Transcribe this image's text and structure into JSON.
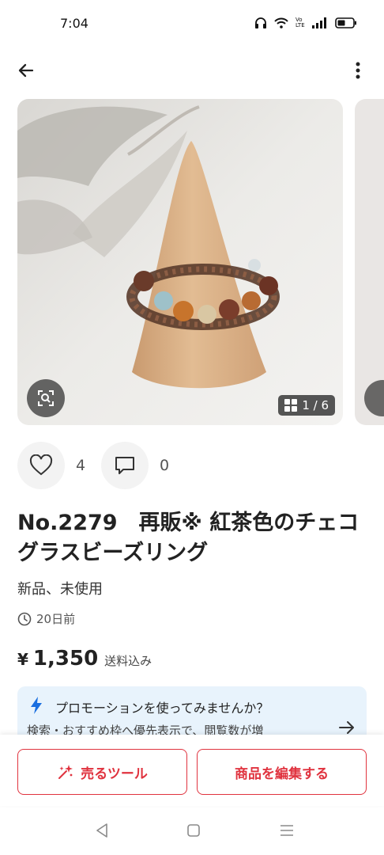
{
  "status_bar": {
    "time": "7:04",
    "network_label": "Vo LTE"
  },
  "product": {
    "photo_counter": "1 / 6",
    "likes_count": "4",
    "comments_count": "0",
    "title": "No.2279　再販※ 紅茶色のチェコグラスビーズリング",
    "condition": "新品、未使用",
    "posted_time": "20日前",
    "price_currency": "¥",
    "price_value": "1,350",
    "price_note": "送料込み"
  },
  "promotion": {
    "title": "プロモーションを使ってみませんか？",
    "body": "検索・おすすめ枠へ優先表示で、閲覧数が増"
  },
  "bottom_actions": {
    "sell_tools_label": "売るツール",
    "edit_label": "商品を編集する"
  },
  "colors": {
    "accent_red": "#e0333f",
    "promo_bg": "#e8f3fc",
    "promo_bolt": "#1a6fe0"
  },
  "icons": [
    "back-arrow-icon",
    "more-vert-icon",
    "image-search-icon",
    "grid-icon",
    "heart-icon",
    "comment-icon",
    "clock-icon",
    "lightning-icon",
    "arrow-right-icon",
    "sparkle-icon",
    "nav-back-icon",
    "nav-home-icon",
    "nav-recents-icon"
  ]
}
